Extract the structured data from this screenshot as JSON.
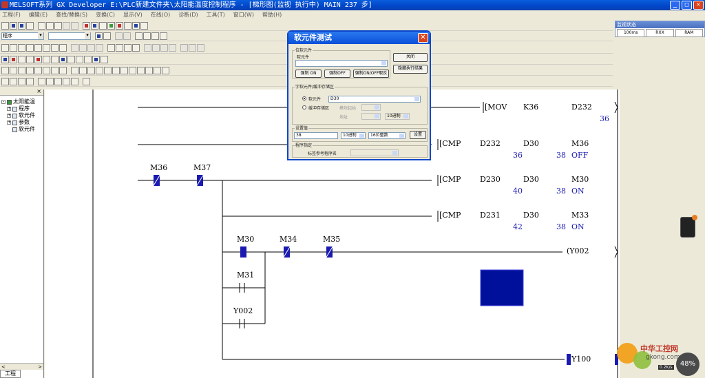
{
  "window": {
    "title": "MELSOFT系列 GX Developer E:\\PLC新建文件夹\\太阳能温度控制程序 - [梯形图(监视 执行中)      MAIN     237 步]",
    "min": "_",
    "max": "□",
    "close": "✕"
  },
  "menu": [
    "工程(F)",
    "编辑(E)",
    "查找/替换(S)",
    "变换(C)",
    "显示(V)",
    "在线(O)",
    "诊断(D)",
    "工具(T)",
    "窗口(W)",
    "帮助(H)"
  ],
  "toolbar": {
    "combo1": "程序",
    "combo2": ""
  },
  "project": {
    "close": "×",
    "tree": [
      {
        "label": "太阳能温",
        "level": 0,
        "expander": "-"
      },
      {
        "label": "程序",
        "level": 1,
        "expander": "+"
      },
      {
        "label": "软元件",
        "level": 1,
        "expander": "+"
      },
      {
        "label": "参数",
        "level": 1,
        "expander": "+"
      },
      {
        "label": "软元件",
        "level": 1,
        "expander": ""
      }
    ],
    "scroll_left": "<",
    "scroll_right": ">",
    "tab": "工程"
  },
  "ladder": {
    "instructions": [
      {
        "op": "[MOV",
        "a": "K36",
        "b": "D232",
        "end": "]"
      },
      {
        "op": "[CMP",
        "a": "D232",
        "b": "D30",
        "c": "M36"
      },
      {
        "op": "[CMP",
        "a": "D230",
        "b": "D30",
        "c": "M30"
      },
      {
        "op": "[CMP",
        "a": "D231",
        "b": "D30",
        "c": "M33"
      }
    ],
    "values": {
      "mov_d232": "36",
      "cmp1_d232": "36",
      "cmp1_d30": "38",
      "cmp1_m": "OFF",
      "cmp2_d230": "40",
      "cmp2_d30": "38",
      "cmp2_m": "ON",
      "cmp3_d231": "42",
      "cmp3_d30": "38",
      "cmp3_m": "ON"
    },
    "contacts": [
      "M36",
      "M37",
      "M30",
      "M34",
      "M35",
      "M31",
      "Y002"
    ],
    "coils": [
      "(Y002",
      "Y100"
    ]
  },
  "monitor": {
    "title": "监视状态",
    "cells": [
      "100ms",
      "RXX",
      "RAM"
    ]
  },
  "watermark": {
    "site": "中华工控网",
    "url": "gkong.com",
    "gauge": "48%",
    "speed": "0.2K/s"
  },
  "dialog": {
    "title": "软元件测试",
    "group_bit": "位软元件",
    "bit_label": "软元件",
    "bit_value": "",
    "btn_force_on": "强制 ON",
    "btn_force_off": "强制OFF",
    "btn_toggle": "强制ON/OFF取反",
    "btn_close": "关闭",
    "btn_hide": "隐藏执行结果",
    "group_word": "字软元件/缓冲存储区",
    "radio_device": "软元件",
    "device_value": "D30",
    "radio_buffer": "缓冲存储区",
    "module_label": "模块起始",
    "address_label": "地址",
    "address_fmt": "10进制",
    "group_setvalue": "设置值",
    "set_value": "38",
    "fmt_decimal": "10进制",
    "fmt_16bit": "16位整数",
    "btn_set": "设置",
    "group_program": "程序指定",
    "label_label": "标签参考程序名"
  }
}
